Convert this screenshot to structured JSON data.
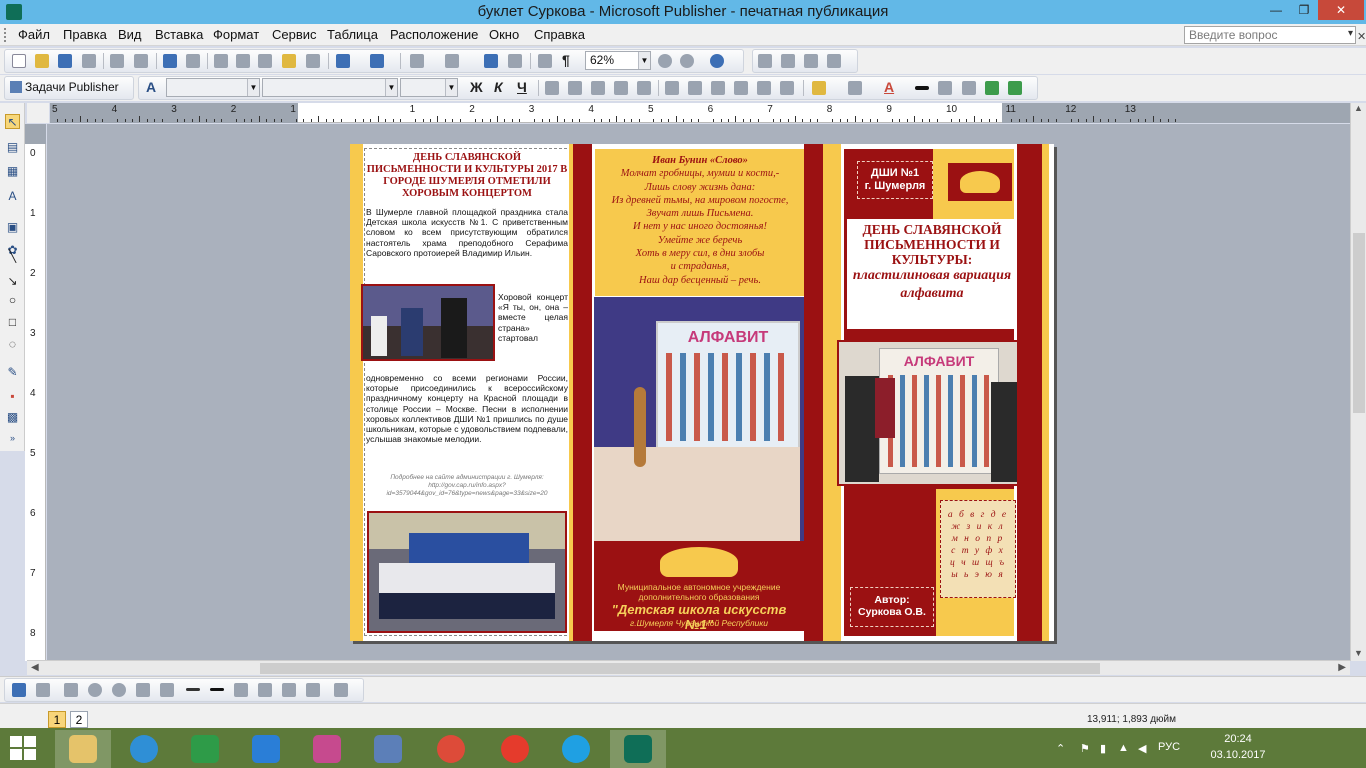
{
  "window": {
    "title": "буклет Суркова - Microsoft Publisher - печатная публикация",
    "minimize": "—",
    "restore": "❐",
    "close": "✕"
  },
  "menu": {
    "items": [
      "Файл",
      "Правка",
      "Вид",
      "Вставка",
      "Формат",
      "Сервис",
      "Таблица",
      "Расположение",
      "Окно",
      "Справка"
    ],
    "ask_placeholder": "Введите вопрос"
  },
  "toolbar": {
    "zoom": "62%",
    "tasks_label": "Задачи Publisher",
    "font_bold": "Ж",
    "font_italic": "К",
    "font_underline": "Ч"
  },
  "rulers": {
    "h_ticks": [
      "5",
      "4",
      "3",
      "2",
      "1",
      "",
      "1",
      "2",
      "3",
      "4",
      "5",
      "6",
      "7",
      "8",
      "9",
      "10",
      "11",
      "12",
      "13"
    ],
    "v_ticks": [
      "0",
      "1",
      "2",
      "3",
      "4",
      "5",
      "6",
      "7",
      "8"
    ]
  },
  "panel1": {
    "headline": "ДЕНЬ СЛАВЯНСКОЙ ПИСЬМЕННОСТИ И КУЛЬТУРЫ 2017 В ГОРОДЕ ШУМЕРЛЯ ОТМЕТИЛИ ХОРОВЫМ КОНЦЕРТОМ",
    "para1": "В Шумерле главной площадкой праздника стала Детская школа искусств №1. С приветственным словом ко всем присутствующим обратился настоятель храма преподобного Серафима Саровского протоиерей Владимир Ильин.",
    "para2": "Хоровой концерт «Я ты, он, она – вместе целая страна» стартовал",
    "para3": "одновременно со всеми регионами России, которые присоединились к всероссийскому праздничному концерту на Красной площади в столице России – Москве. Песни в исполнении хоровых коллективов ДШИ №1 пришлись по душе школьникам, которые с удовольствием подпевали, услышав знакомые мелодии.",
    "credit": "Подробнее на сайте администрации г. Шумерля: http://gov.cap.ru/info.aspx?id=3579044&gov_id=76&type=news&page=33&size=20"
  },
  "panel2": {
    "poem_title": "Иван Бунин «Слово»",
    "poem_lines": [
      "Молчат гробницы, мумии и кости,-",
      "Лишь слову жизнь дана:",
      "Из древней тьмы, на мировом погосте,",
      "Звучат лишь Письмена.",
      "И нет у нас иного достоянья!",
      "Умейте же беречь",
      "Хоть в меру сил, в дни злобы",
      "и страданья,",
      "Наш дар бесценный – речь."
    ],
    "photo_sign": "АЛФАВИТ",
    "school_line1": "Муниципальное автономное учреждение",
    "school_line2": "дополнительного образования",
    "school_name": "\"Детская школа искусств №1\"",
    "school_city": "г.Шумерля Чувашской Республики"
  },
  "panel3": {
    "dshi_line1": "ДШИ №1",
    "dshi_line2": "г. Шумерля",
    "title_line1": "ДЕНЬ СЛАВЯНСКОЙ ПИСЬМЕННОСТИ И КУЛЬТУРЫ:",
    "title_line2": "пластилиновая вариация алфавита",
    "photo_sign": "АЛФАВИТ",
    "alphabet": "а б в г д е ж з и к л м н о п р с т у ф х ц ч ш щ ъ ы ь э ю я",
    "author_label": "Автор:",
    "author_name": "Суркова О.В."
  },
  "status": {
    "page1": "1",
    "page2": "2",
    "coords": "13,911; 1,893 дюйм"
  },
  "taskbar": {
    "lang": "РУС",
    "time": "20:24",
    "date": "03.10.2017"
  },
  "colors": {
    "brand_red": "#9b1112",
    "brand_yellow": "#f7c94d"
  }
}
